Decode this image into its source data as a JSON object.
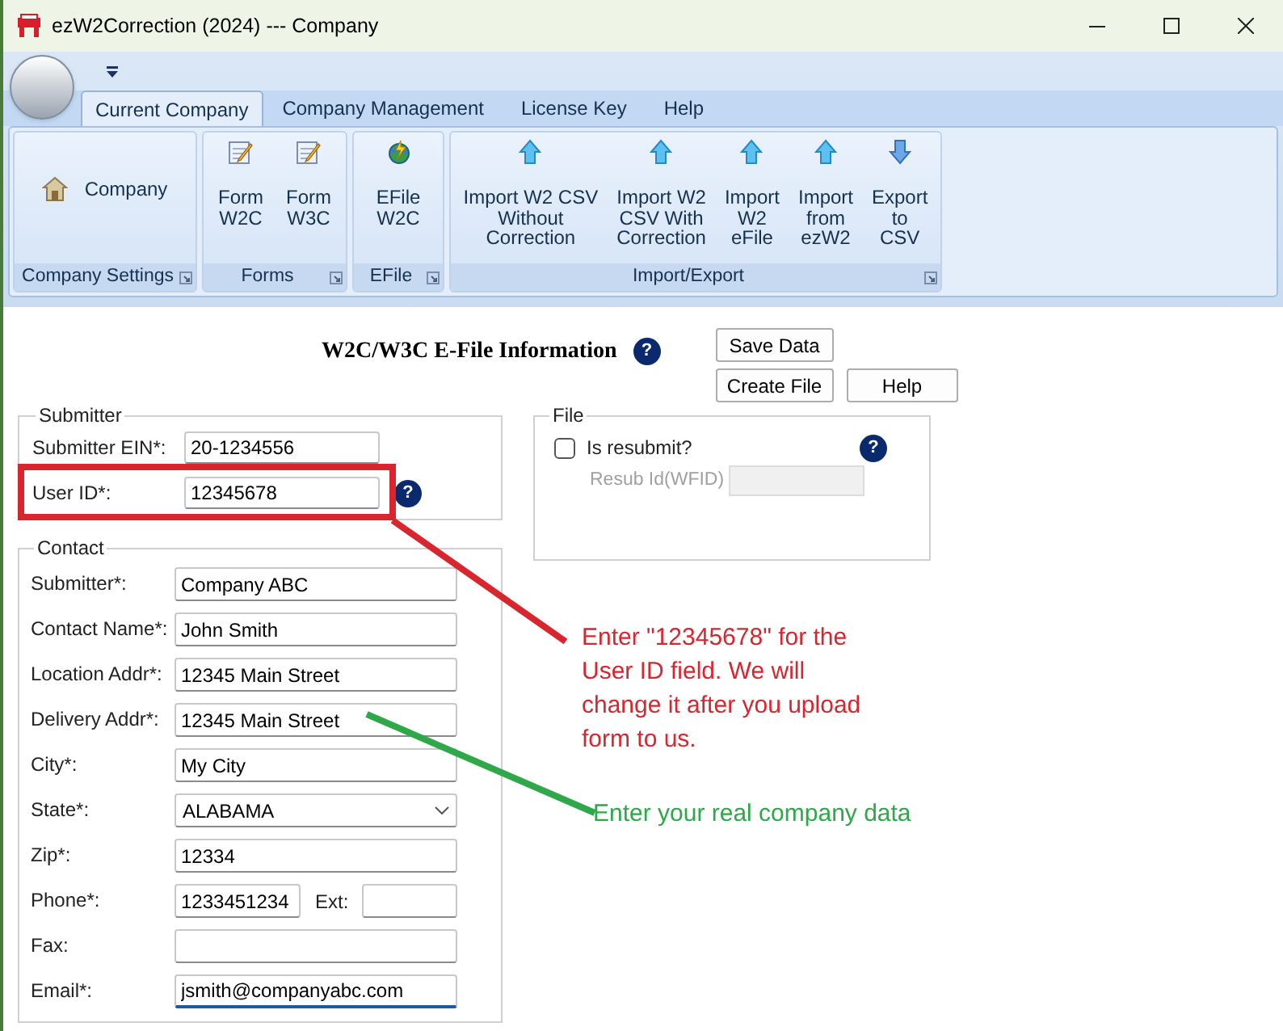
{
  "window": {
    "title": "ezW2Correction (2024) --- Company"
  },
  "ribbon": {
    "tabs": [
      {
        "label": "Current Company",
        "selected": true
      },
      {
        "label": "Company Management",
        "selected": false
      },
      {
        "label": "License Key",
        "selected": false
      },
      {
        "label": "Help",
        "selected": false
      }
    ],
    "groups": [
      {
        "label": "Company Settings",
        "buttons": [
          {
            "kind": "house",
            "lines": [
              "Company"
            ]
          }
        ]
      },
      {
        "label": "Forms",
        "buttons": [
          {
            "kind": "form",
            "lines": [
              "Form",
              "W2C"
            ]
          },
          {
            "kind": "form",
            "lines": [
              "Form",
              "W3C"
            ]
          }
        ]
      },
      {
        "label": "EFile",
        "buttons": [
          {
            "kind": "globe",
            "lines": [
              "EFile",
              "W2C"
            ]
          }
        ]
      },
      {
        "label": "Import/Export",
        "buttons": [
          {
            "kind": "up",
            "lines": [
              "Import W2 CSV",
              "Without",
              "Correction"
            ]
          },
          {
            "kind": "up",
            "lines": [
              "Import W2",
              "CSV With",
              "Correction"
            ]
          },
          {
            "kind": "up",
            "lines": [
              "Import",
              "W2",
              "eFile"
            ]
          },
          {
            "kind": "up",
            "lines": [
              "Import",
              "from",
              "ezW2"
            ]
          },
          {
            "kind": "down",
            "lines": [
              "Export",
              "to",
              "CSV"
            ]
          }
        ]
      }
    ]
  },
  "form": {
    "title": "W2C/W3C E-File Information",
    "title_help": "?",
    "buttons": [
      "Save Data",
      "Create File",
      "Help"
    ],
    "submitter": {
      "title": "Submitter",
      "fields": [
        {
          "label": "Submitter EIN*:",
          "value": "20-1234556"
        },
        {
          "label": "User ID*:",
          "value": "12345678",
          "help": "?"
        }
      ]
    },
    "file": {
      "title": "File",
      "resubmit": {
        "label": "Is resubmit?",
        "checked": false,
        "help": "?"
      },
      "resub_id": {
        "label": "Resub Id(WFID)",
        "disabled": true
      }
    },
    "contact": {
      "title": "Contact",
      "fields": [
        {
          "kind": "text",
          "label": "Submitter*:",
          "value": "Company ABC"
        },
        {
          "kind": "text",
          "label": "Contact Name*:",
          "value": "John Smith"
        },
        {
          "kind": "text",
          "label": "Location Addr*:",
          "value": "12345 Main Street"
        },
        {
          "kind": "text",
          "label": "Delivery Addr*:",
          "value": "12345 Main Street"
        },
        {
          "kind": "text",
          "label": "City*:",
          "value": "My City"
        },
        {
          "kind": "select",
          "label": "State*:",
          "value": "ALABAMA"
        },
        {
          "kind": "text",
          "label": "Zip*:",
          "value": "12334"
        },
        {
          "kind": "phone",
          "label": "Phone*:",
          "value": "1233451234",
          "ext_label": "Ext:"
        },
        {
          "kind": "text",
          "label": "Fax:"
        },
        {
          "kind": "text",
          "label": "Email*:",
          "value": "jsmith@companyabc.com",
          "focused": true
        }
      ]
    }
  },
  "annotations": [
    {
      "kind": "callout",
      "text": "Enter \"12345678\" for the User ID field. We will change it after you upload form to us.",
      "color": "#d9262e"
    },
    {
      "kind": "callout",
      "text": "Enter your real company data",
      "color": "#2fa84a"
    }
  ]
}
